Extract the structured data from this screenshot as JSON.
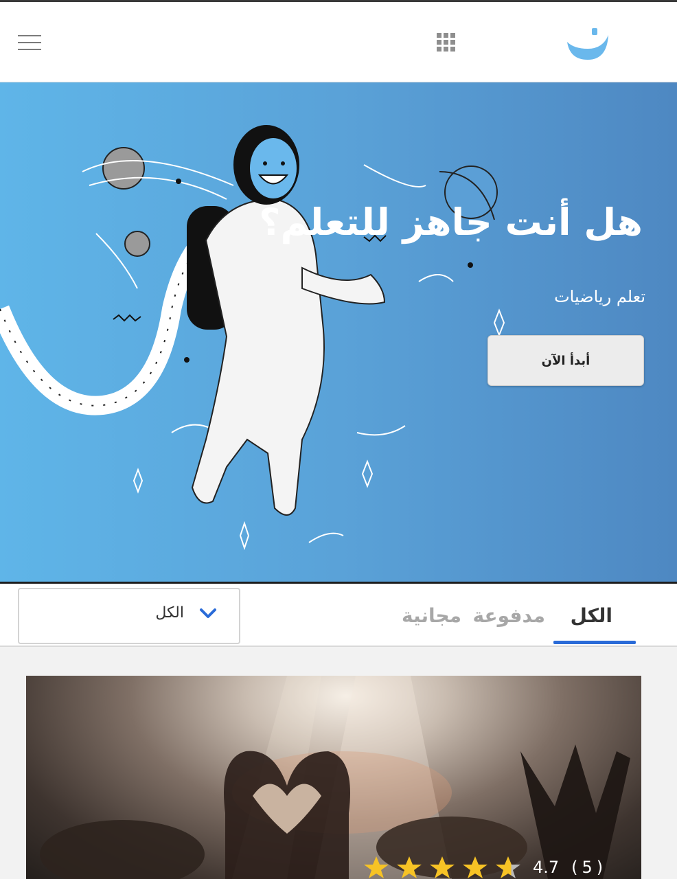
{
  "header": {
    "menu_icon": "hamburger-menu-icon",
    "apps_icon": "grid-apps-icon",
    "logo": "smile-logo"
  },
  "hero": {
    "title": "هل أنت جاهز للتعلم؟",
    "subtitle": "تعلم رياضيات",
    "button_label": "أبدأ الآن",
    "illustration": "astronaut-illustration",
    "gradient_colors": [
      "#5fb5e8",
      "#4e88c2"
    ]
  },
  "filter": {
    "tabs": [
      {
        "label": "الكل",
        "active": true
      },
      {
        "label": "مدفوعة",
        "active": false
      },
      {
        "label": "مجانية",
        "active": false
      }
    ],
    "dropdown_value": "الكل",
    "accent_color": "#2a6bd8"
  },
  "card": {
    "image": "concert-heart-hands-photo",
    "rating_value": "4.7",
    "rating_count": "(5)",
    "stars": 4.7
  }
}
